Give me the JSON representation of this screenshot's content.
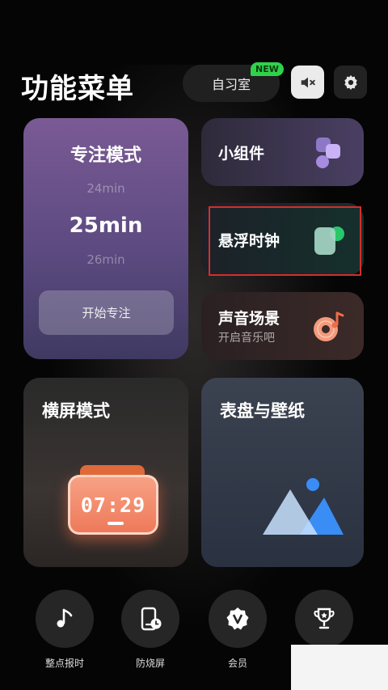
{
  "header": {
    "title": "功能菜单",
    "study_room_label": "自习室",
    "new_badge": "NEW",
    "mute_icon": "volume-mute-icon",
    "settings_icon": "gear-icon"
  },
  "focus_mode": {
    "title": "专注模式",
    "time_prev": "24min",
    "time_current": "25min",
    "time_next": "26min",
    "start_button": "开始专注"
  },
  "cards": {
    "widgets": {
      "label": "小组件",
      "icon": "widgets-icon"
    },
    "floating_clock": {
      "label": "悬浮时钟",
      "icon": "floating-clock-icon"
    },
    "sound_scene": {
      "label": "声音场景",
      "subtitle": "开启音乐吧",
      "icon": "music-record-icon"
    },
    "landscape_mode": {
      "label": "横屏模式",
      "clock_text": "07:29"
    },
    "dial_wallpaper": {
      "label": "表盘与壁纸",
      "icon": "mountain-image-icon"
    }
  },
  "bottom_nav": [
    {
      "label": "整点报时",
      "icon": "music-note-icon"
    },
    {
      "label": "防烧屏",
      "icon": "phone-clock-icon"
    },
    {
      "label": "会员",
      "icon": "vip-badge-icon"
    },
    {
      "label": "",
      "icon": "trophy-icon"
    }
  ],
  "colors": {
    "focus_card": "#6a5290",
    "highlight_outline": "#d72c2c",
    "new_badge": "#2fd24b",
    "accent_green": "#29c76a",
    "accent_blue": "#3a8df5",
    "accent_orange": "#ee7a5a"
  }
}
